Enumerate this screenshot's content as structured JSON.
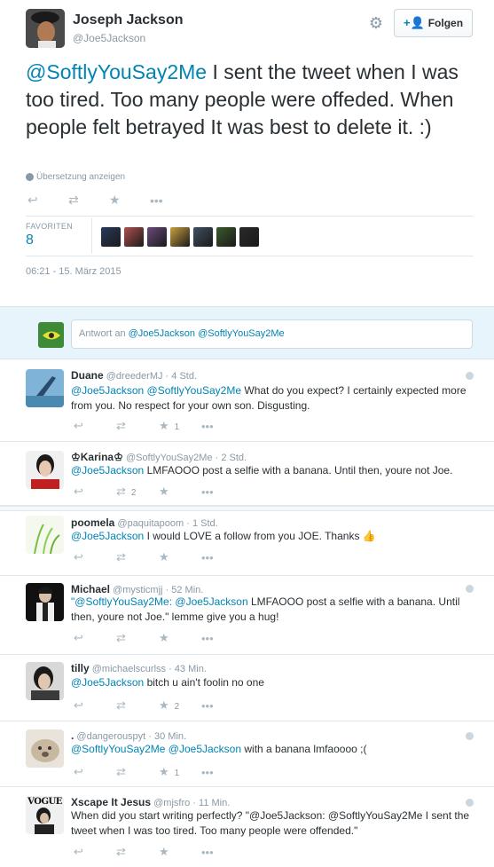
{
  "tweet": {
    "author_name": "Joseph Jackson",
    "author_handle": "@Joe5Jackson",
    "follow_label": "Folgen",
    "mention": "@SoftlyYouSay2Me",
    "text": " I sent the tweet when I was too tired. Too many people were offeded. When people felt betrayed It was best to delete it. :)",
    "translate_label": "Übersetzung anzeigen",
    "favorites_label": "FAVORITEN",
    "favorites_count": "8",
    "timestamp": "06:21 - 15. März 2015",
    "fav_avatar_colors": [
      "#2a3a5a",
      "#b05050",
      "#6a4a7a",
      "#c8a040",
      "#405060",
      "#3a5a2a",
      "#2a2a2a"
    ]
  },
  "reply_box": {
    "placeholder_prefix": "Antwort an ",
    "placeholder_mentions": "@Joe5Jackson @SoftlyYouSay2Me"
  },
  "replies": [
    {
      "name": "Duane",
      "handle": "@dreederMJ",
      "time": "4 Std.",
      "mentions": "@Joe5Jackson @SoftlyYouSay2Me",
      "text": " What do you expect? I certainly expected more from you. No respect for your own son. Disgusting.",
      "fav_count": "1",
      "rt_count": ""
    },
    {
      "name": "♔Karina♔",
      "handle": "@SoftlyYouSay2Me",
      "time": "2 Std.",
      "mentions": "@Joe5Jackson",
      "text": " LMFAOOO post a selfie with a banana. Until then, youre not Joe.",
      "fav_count": "",
      "rt_count": "2"
    },
    {
      "name": "poomela",
      "handle": "@paquitapoom",
      "time": "1 Std.",
      "mentions": "@Joe5Jackson",
      "text": "  I would LOVE a follow from you JOE. Thanks 👍",
      "fav_count": "",
      "rt_count": ""
    },
    {
      "name": "Michael",
      "handle": "@mysticmjj",
      "time": "52 Min.",
      "mentions": "\"@SoftlyYouSay2Me: @Joe5Jackson",
      "text": " LMFAOOO post a selfie with a banana. Until then, youre not Joe.\" lemme give you a hug!",
      "fav_count": "",
      "rt_count": ""
    },
    {
      "name": "tilly",
      "handle": "@michaelscurlss",
      "time": "43 Min.",
      "mentions": "@Joe5Jackson",
      "text": " bitch u ain't foolin no one",
      "fav_count": "2",
      "rt_count": ""
    },
    {
      "name": ".",
      "handle": "@dangerouspyt",
      "time": "30 Min.",
      "mentions": "@SoftlyYouSay2Me @Joe5Jackson",
      "text": " with a banana lmfaoooo ;(",
      "fav_count": "1",
      "rt_count": ""
    },
    {
      "name": "Xscape It Jesus",
      "handle": "@mjsfro",
      "time": "11 Min.",
      "mentions": "",
      "text": "When did you start writing perfectly? \"@Joe5Jackson: @SoftlyYouSay2Me I sent the tweet when I was too tired. Too many people were offended.\"",
      "fav_count": "",
      "rt_count": "",
      "avatar_text": "VOGUE"
    }
  ],
  "colors": {
    "link": "#0084b4",
    "muted": "#8899a6",
    "reply_bg": "#e8f4fb"
  }
}
